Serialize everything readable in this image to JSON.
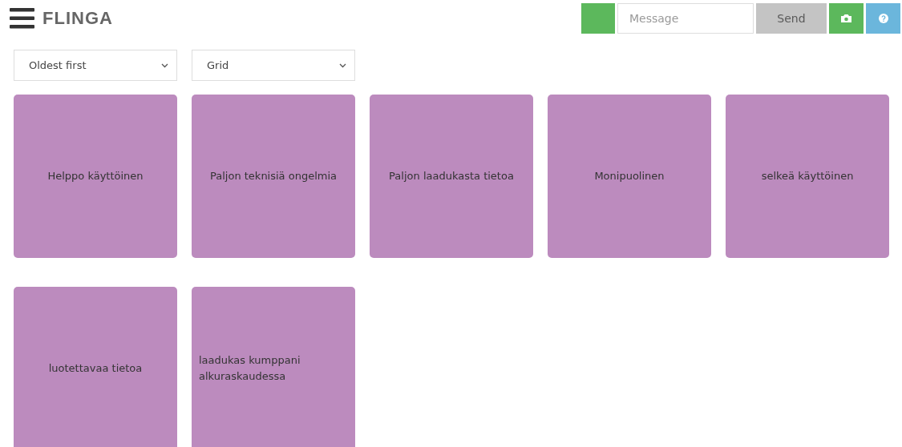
{
  "header": {
    "logo": "FLINGA",
    "message": {
      "placeholder": "Message"
    },
    "send_button": {
      "label": "Send",
      "disabled": true
    }
  },
  "filters": [
    {
      "value": "Oldest first"
    },
    {
      "value": "Grid"
    }
  ],
  "cards": [
    {
      "text": "Helppo käyttöinen"
    },
    {
      "text": "Paljon teknisiä ongelmia"
    },
    {
      "text": "Paljon laadukasta tietoa"
    },
    {
      "text": "Monipuolinen"
    },
    {
      "text": "selkeä käyttöinen"
    },
    {
      "text": "luotettavaa tietoa"
    },
    {
      "text": "laadukas kumppani alkuraskaudessa"
    }
  ]
}
